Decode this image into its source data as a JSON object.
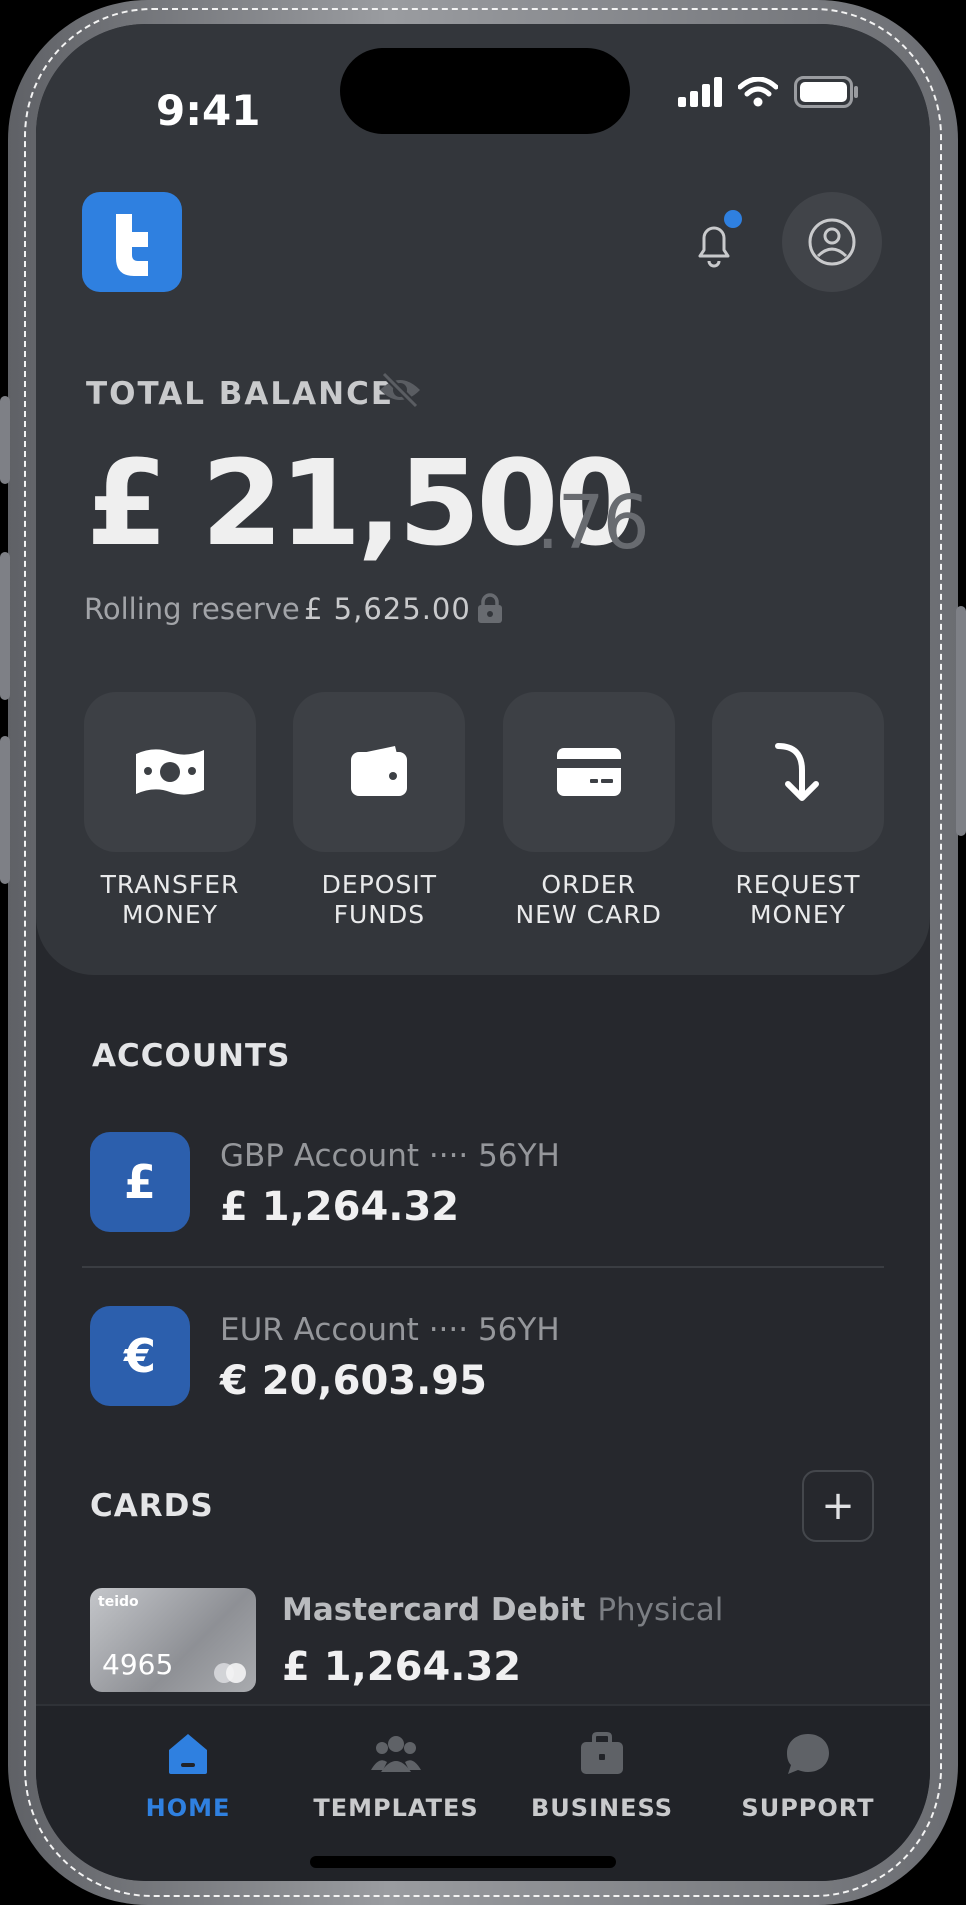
{
  "status_bar": {
    "time": "9:41"
  },
  "header": {
    "logo_icon": "teido-logo-icon",
    "bell_icon": "bell-icon",
    "profile_icon": "profile-icon",
    "notification_color": "#2f80e0"
  },
  "balance": {
    "label": "TOTAL BALANCE",
    "amount_main": "£ 21,500",
    "amount_cents": ".76",
    "reserve_label": "Rolling reserve",
    "reserve_amount": "£ 5,625.00"
  },
  "actions": [
    {
      "label": "TRANSFER\nMONEY",
      "icon": "banknote-icon"
    },
    {
      "label": "DEPOSIT\nFUNDS",
      "icon": "wallet-icon"
    },
    {
      "label": "ORDER\nNEW CARD",
      "icon": "card-icon"
    },
    {
      "label": "REQUEST\nMONEY",
      "icon": "arrow-down-icon"
    }
  ],
  "accounts": {
    "title": "ACCOUNTS",
    "items": [
      {
        "symbol": "£",
        "name": "GBP Account ···· 56YH",
        "balance": "£ 1,264.32"
      },
      {
        "symbol": "€",
        "name": "EUR Account ···· 56YH",
        "balance": "€ 20,603.95"
      }
    ]
  },
  "cards": {
    "title": "CARDS",
    "add_label": "+",
    "items": [
      {
        "brand": "teido",
        "last4": "4965",
        "name": "Mastercard Debit",
        "type": "Physical",
        "balance": "£ 1,264.32"
      }
    ]
  },
  "tabbar": {
    "active_color": "#2f80e0",
    "tabs": [
      {
        "label": "HOME",
        "icon": "home-icon",
        "active": true
      },
      {
        "label": "TEMPLATES",
        "icon": "users-icon",
        "active": false
      },
      {
        "label": "BUSINESS",
        "icon": "briefcase-icon",
        "active": false
      },
      {
        "label": "SUPPORT",
        "icon": "chat-icon",
        "active": false
      }
    ]
  }
}
